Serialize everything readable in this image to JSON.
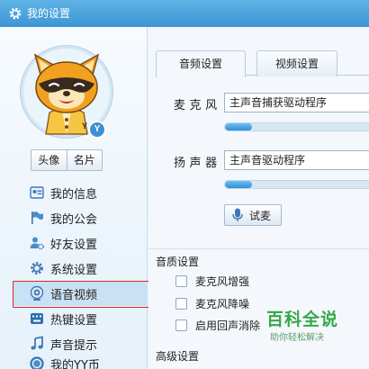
{
  "window": {
    "title": "我的设置",
    "icon": "gear-icon"
  },
  "avatar": {
    "badge_text": "Y",
    "buttons": [
      {
        "label": "头像"
      },
      {
        "label": "名片"
      }
    ]
  },
  "nav": {
    "items": [
      {
        "label": "我的信息",
        "icon": "id-card-icon"
      },
      {
        "label": "我的公会",
        "icon": "flag-icon"
      },
      {
        "label": "好友设置",
        "icon": "user-gear-icon"
      },
      {
        "label": "系统设置",
        "icon": "gear-icon"
      },
      {
        "label": "语音视频",
        "icon": "webcam-icon",
        "selected": true
      },
      {
        "label": "热键设置",
        "icon": "keyboard-icon"
      },
      {
        "label": "声音提示",
        "icon": "music-note-icon"
      },
      {
        "label": "我的YY币",
        "icon": "coin-icon"
      }
    ]
  },
  "tabs": [
    {
      "label": "音频设置",
      "active": true
    },
    {
      "label": "视频设置",
      "active": false
    }
  ],
  "audio": {
    "microphone": {
      "label": "麦克风",
      "value": "主声音捕获驱动程序",
      "level": 0.18
    },
    "speaker": {
      "label": "扬声器",
      "value": "主声音驱动程序",
      "level": 0.18
    },
    "test_button": "试麦"
  },
  "quality": {
    "title": "音质设置",
    "options": [
      {
        "label": "麦克风增强",
        "checked": false
      },
      {
        "label": "麦克风降噪",
        "checked": false
      },
      {
        "label": "启用回声消除",
        "checked": false
      }
    ]
  },
  "advanced": {
    "title": "高级设置"
  },
  "watermark": {
    "main": "百科全说",
    "sub": "助你轻松解决"
  },
  "colors": {
    "titlebar": "#3c96d3",
    "selected_nav": "#c9e1f4",
    "highlight_box": "#e02424",
    "meter_fill": "#2f8fd6",
    "watermark": "#35a84a"
  }
}
